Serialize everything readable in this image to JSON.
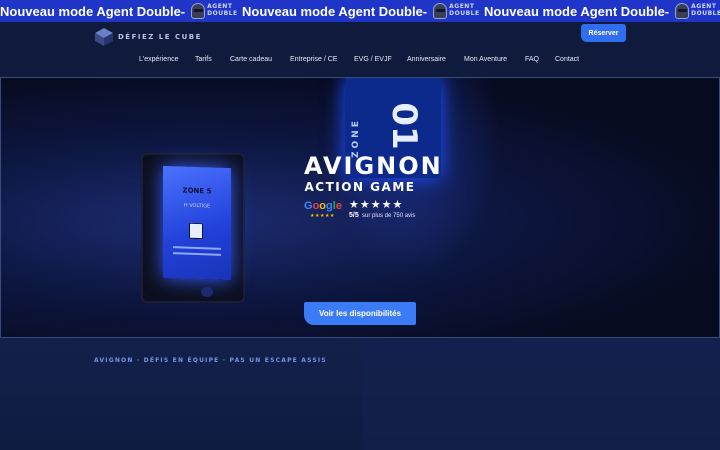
{
  "ticker": {
    "items": [
      {
        "text": "Nouveau mode Agent Double-",
        "logo_text": "AGENT DOUBLE"
      },
      {
        "text": "Nouveau mode Agent Double-",
        "logo_text": "AGENT DOUBLE"
      },
      {
        "text": "Nouveau mode Agent Double-",
        "logo_text": "AGENT DOUBLE"
      }
    ],
    "background": "#1f35c8"
  },
  "header": {
    "brand_name": "DÉFIEZ LE CUBE",
    "reserve_label": "Réserver",
    "nav": [
      "L'expérience",
      "Tarifs",
      "Carte cadeau",
      "Entreprise / CE",
      "EVG / EVJF",
      "Anniversaire",
      "Mon Aventure",
      "FAQ",
      "Contact"
    ]
  },
  "hero": {
    "zone_sign_word": "ZONE",
    "zone_sign_number": "01",
    "screen_title": "ZONE 5",
    "screen_subtitle": "H VOLTIGE",
    "city": "AVIGNON",
    "subtitle": "ACTION GAME",
    "rating": {
      "provider": "Google",
      "stars": "★★★★★",
      "score": "5/5",
      "count_text": "sur plus de 750 avis"
    },
    "cta_label": "Voir les disponibilités"
  },
  "section": {
    "tagline": "AVIGNON · DÉFIS EN ÉQUIPE · PAS UN ESCAPE ASSIS"
  },
  "colors": {
    "accent": "#3b7bf7",
    "header_bg": "#0f1a3c",
    "page_bg": "#0b1430"
  }
}
